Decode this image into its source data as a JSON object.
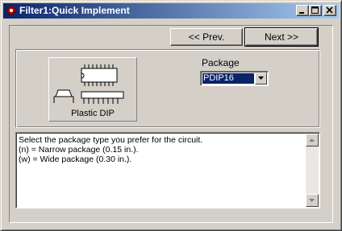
{
  "window": {
    "title": "Filter1:Quick Implement",
    "app_icon": "filter-app-icon",
    "controls": {
      "minimize": "minimize-icon",
      "maximize": "maximize-icon",
      "close": "close-icon"
    }
  },
  "nav": {
    "prev_label": "<< Prev.",
    "next_label": "Next >>"
  },
  "package": {
    "image_caption": "Plastic DIP",
    "image_icon": "dip-package-icon",
    "label": "Package",
    "selected": "PDIP16"
  },
  "description": {
    "lines": [
      "Select the package type you prefer for the circuit.",
      "(n) = Narrow package (0.15 in.).",
      "(w) = Wide package (0.30 in.)."
    ]
  },
  "colors": {
    "titlebar_start": "#0a246a",
    "titlebar_end": "#a6caf0",
    "face": "#d4d0c8",
    "selection": "#0a246a"
  }
}
